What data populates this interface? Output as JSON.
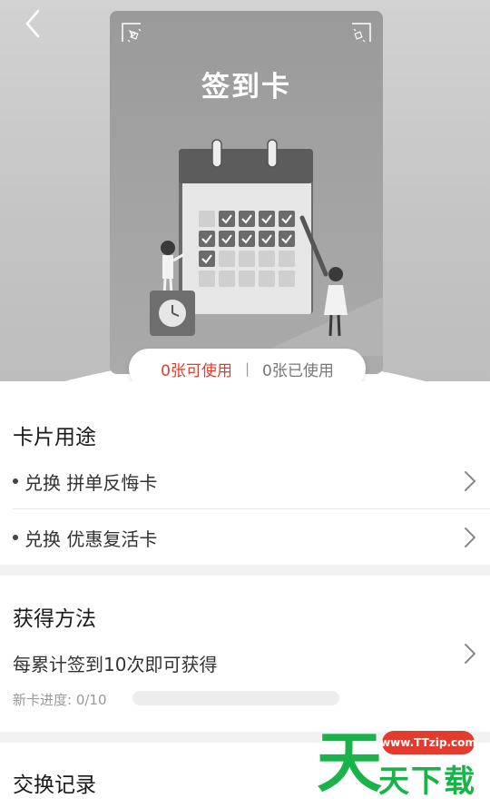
{
  "header": {
    "card_title": "签到卡",
    "available_label": "0张可使用",
    "separator": "|",
    "used_label": "0张已使用"
  },
  "usage": {
    "title": "卡片用途",
    "items": [
      {
        "label": "兑换 拼单反悔卡"
      },
      {
        "label": "兑换 优惠复活卡"
      }
    ]
  },
  "method": {
    "title": "获得方法",
    "description": "每累计签到10次即可获得",
    "progress_label": "新卡进度: 0/10",
    "progress_fraction": 0
  },
  "records": {
    "title": "交换记录"
  },
  "watermark": {
    "url": "www.TTzip.com",
    "big_char": "天",
    "text": "天下载"
  },
  "colors": {
    "accent": "#e33b2e",
    "watermark_green": "#19b34a"
  },
  "icons": [
    "back-arrow-icon",
    "chevron-right-icon",
    "calendar-illustration",
    "clock-icon"
  ]
}
